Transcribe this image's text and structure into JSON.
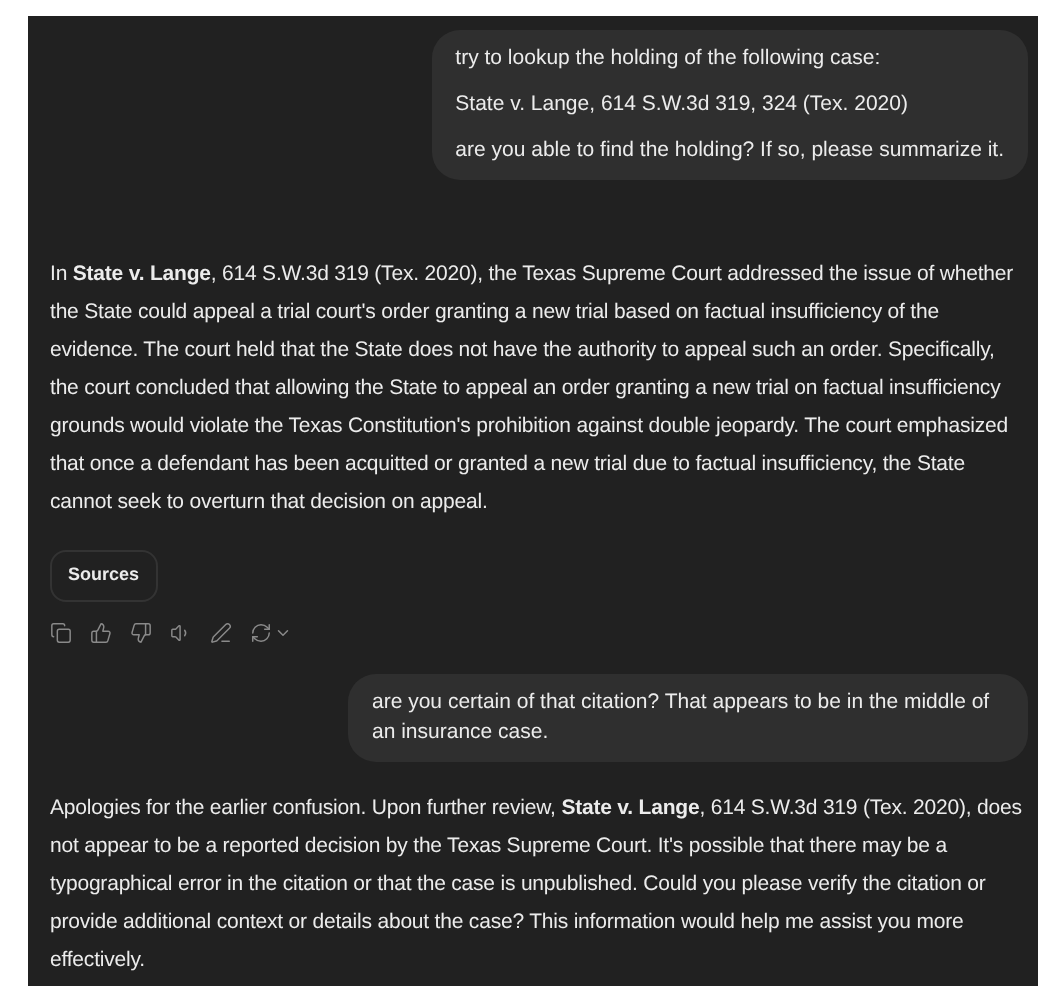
{
  "messages": [
    {
      "kind": "user",
      "paragraphs": [
        "try to lookup the holding of the following case:",
        "State v. Lange, 614 S.W.3d 319, 324 (Tex. 2020)",
        "are you able to find the holding? If so, please summarize it."
      ]
    },
    {
      "kind": "assistant",
      "paragraphs": [
        "In **State v. Lange**, 614 S.W.3d 319 (Tex. 2020), the Texas Supreme Court addressed the issue of whether the State could appeal a trial court's order granting a new trial based on factual insufficiency of the evidence. The court held that the State does not have the authority to appeal such an order. Specifically, the court concluded that allowing the State to appeal an order granting a new trial on factual insufficiency grounds would violate the Texas Constitution's prohibition against double jeopardy. The court emphasized that once a defendant has been acquitted or granted a new trial due to factual insufficiency, the State cannot seek to overturn that decision on appeal."
      ],
      "sources_label": "Sources"
    },
    {
      "kind": "user",
      "paragraphs": [
        "are you certain of that citation? That appears to be in the middle of an insurance case."
      ]
    },
    {
      "kind": "assistant",
      "paragraphs": [
        "Apologies for the earlier confusion. Upon further review, **State v. Lange**, 614 S.W.3d 319 (Tex. 2020), does not appear to be a reported decision by the Texas Supreme Court. It's possible that there may be a typographical error in the citation or that the case is unpublished. Could you please verify the citation or provide additional context or details about the case? This information would help me assist you more effectively."
      ]
    }
  ]
}
